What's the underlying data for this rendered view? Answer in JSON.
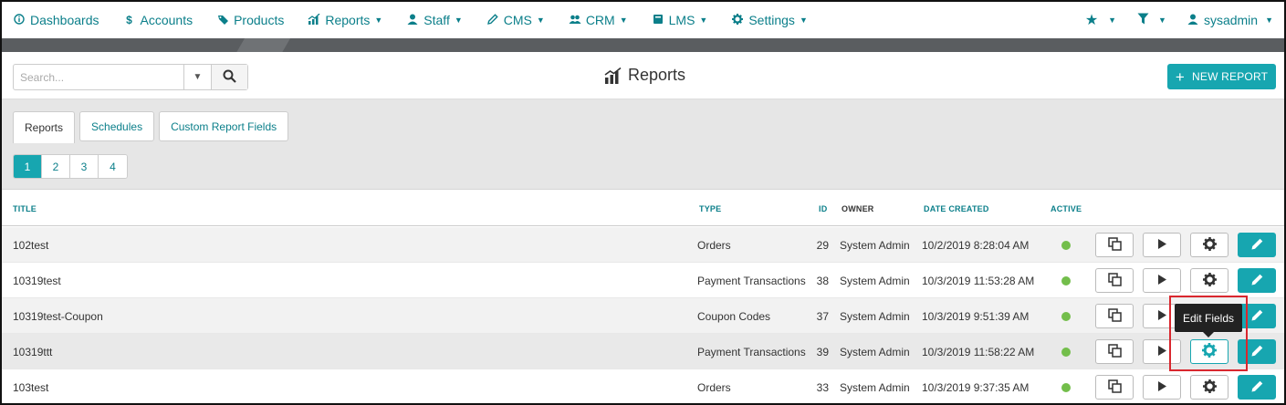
{
  "nav": {
    "left": [
      {
        "label": "Dashboards",
        "icon": "info-circle-icon",
        "caret": false
      },
      {
        "label": "Accounts",
        "icon": "dollar-icon",
        "caret": false
      },
      {
        "label": "Products",
        "icon": "tag-icon",
        "caret": false
      },
      {
        "label": "Reports",
        "icon": "bar-chart-icon",
        "caret": true
      },
      {
        "label": "Staff",
        "icon": "user-icon",
        "caret": true
      },
      {
        "label": "CMS",
        "icon": "pencil-icon",
        "caret": true
      },
      {
        "label": "CRM",
        "icon": "users-icon",
        "caret": true
      },
      {
        "label": "LMS",
        "icon": "book-icon",
        "caret": true
      },
      {
        "label": "Settings",
        "icon": "gear-icon",
        "caret": true
      }
    ],
    "user": "sysadmin"
  },
  "search": {
    "placeholder": "Search..."
  },
  "page": {
    "title": "Reports",
    "new_report_label": "NEW REPORT"
  },
  "tabs": [
    "Reports",
    "Schedules",
    "Custom Report Fields"
  ],
  "pagination": [
    "1",
    "2",
    "3",
    "4"
  ],
  "table": {
    "headers": {
      "title": "TITLE",
      "type": "TYPE",
      "id": "ID",
      "owner": "OWNER",
      "date": "DATE CREATED",
      "active": "ACTIVE"
    },
    "rows": [
      {
        "title": "102test",
        "type": "Orders",
        "id": "29",
        "owner": "System Admin",
        "date": "10/2/2019 8:28:04 AM",
        "active": true
      },
      {
        "title": "10319test",
        "type": "Payment Transactions",
        "id": "38",
        "owner": "System Admin",
        "date": "10/3/2019 11:53:28 AM",
        "active": true
      },
      {
        "title": "10319test-Coupon",
        "type": "Coupon Codes",
        "id": "37",
        "owner": "System Admin",
        "date": "10/3/2019 9:51:39 AM",
        "active": true
      },
      {
        "title": "10319ttt",
        "type": "Payment Transactions",
        "id": "39",
        "owner": "System Admin",
        "date": "10/3/2019 11:58:22 AM",
        "active": true
      },
      {
        "title": "103test",
        "type": "Orders",
        "id": "33",
        "owner": "System Admin",
        "date": "10/3/2019 9:37:35 AM",
        "active": true
      }
    ]
  },
  "tooltip": {
    "text": "Edit Fields"
  },
  "colors": {
    "accent": "#17a6b0",
    "link": "#0b7f8a",
    "active_dot": "#73be4b",
    "highlight": "#d9272e"
  }
}
